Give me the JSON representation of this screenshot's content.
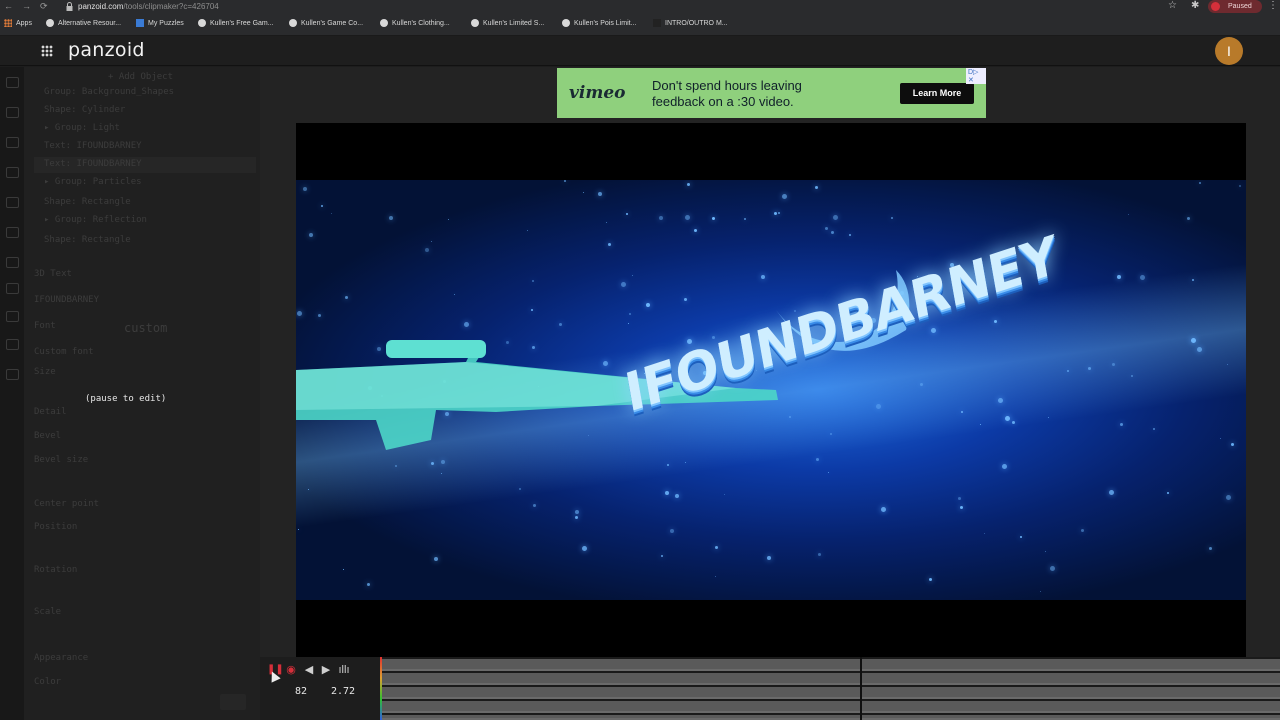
{
  "browser": {
    "url_host": "panzoid.com",
    "url_path": "/tools/clipmaker?c=426704",
    "paused_label": "Paused",
    "bookmarks": [
      {
        "label": "Apps"
      },
      {
        "label": "Alternative Resour..."
      },
      {
        "label": "My Puzzles"
      },
      {
        "label": "Kullen's Free Gam..."
      },
      {
        "label": "Kullen's Game Co..."
      },
      {
        "label": "Kullen's Clothing..."
      },
      {
        "label": "Kullen's Limited S..."
      },
      {
        "label": "Kullen's Pois Limit..."
      },
      {
        "label": "INTRO/OUTRO M..."
      }
    ]
  },
  "app": {
    "logo": "panzoid",
    "avatar_letter": "I"
  },
  "editor": {
    "pause_note": "(pause to edit)",
    "ghost_lines": [
      "+ Add Object",
      "Group: Background_Shapes",
      "Shape: Cylinder",
      "▸ Group: Light",
      "Text: IFOUNDBARNEY",
      "Text: IFOUNDBARNEY",
      "▸ Group: Particles",
      "Shape: Rectangle",
      "▸ Group: Reflection",
      "Shape: Rectangle",
      "3D Text",
      "IFOUNDBARNEY",
      "Font",
      "custom",
      "Custom font",
      "Size",
      "Detail",
      "Bevel",
      "Bevel size",
      "Center point",
      "Position",
      "Rotation",
      "Scale",
      "Appearance",
      "Color"
    ]
  },
  "ad": {
    "brand": "vimeo",
    "headline_line1": "Don't spend hours leaving",
    "headline_line2": "feedback on a :30 video.",
    "cta": "Learn More",
    "adchoices": "D▷ ✕"
  },
  "video": {
    "title_text": "IFOUNDBARNEY"
  },
  "timeline": {
    "frame": "82",
    "time": "2.72"
  },
  "colors": {
    "accent_red": "#d52f3a",
    "ad_green": "#8fd07d",
    "avatar": "#b87a2a"
  }
}
